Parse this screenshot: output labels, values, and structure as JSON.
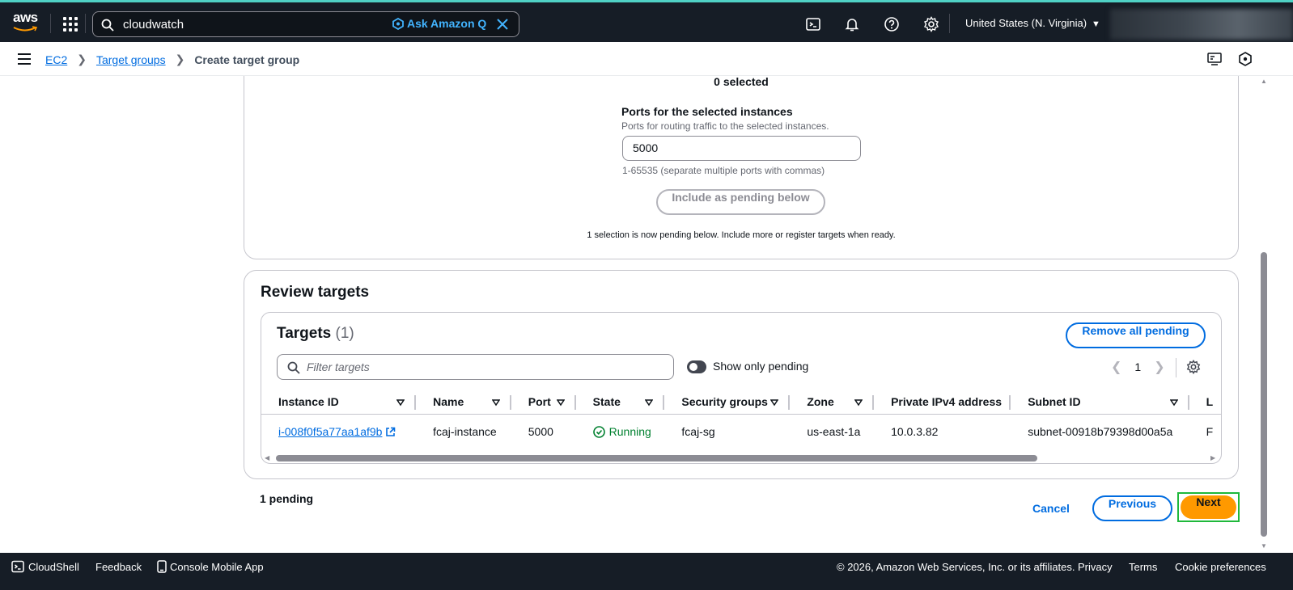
{
  "topnav": {
    "logo": "aws",
    "search_value": "cloudwatch",
    "ask_q": "Ask Amazon Q",
    "region": "United States (N. Virginia)"
  },
  "breadcrumb": {
    "items": [
      "EC2",
      "Target groups"
    ],
    "current": "Create target group"
  },
  "register": {
    "selected_count": "0 selected",
    "ports_label": "Ports for the selected instances",
    "ports_desc": "Ports for routing traffic to the selected instances.",
    "ports_value": "5000",
    "ports_hint": "1-65535 (separate multiple ports with commas)",
    "include_btn": "Include as pending below",
    "pending_note": "1 selection is now pending below. Include more or register targets when ready."
  },
  "review": {
    "title": "Review targets",
    "targets_title": "Targets",
    "targets_count": "(1)",
    "remove_btn": "Remove all pending",
    "filter_placeholder": "Filter targets",
    "toggle_label": "Show only pending",
    "page": "1",
    "columns": [
      "Instance ID",
      "Name",
      "Port",
      "State",
      "Security groups",
      "Zone",
      "Private IPv4 address",
      "Subnet ID",
      "L"
    ],
    "rows": [
      {
        "instance_id": "i-008f0f5a77aa1af9b",
        "name": "fcaj-instance",
        "port": "5000",
        "state": "Running",
        "security_groups": "fcaj-sg",
        "zone": "us-east-1a",
        "ipv4": "10.0.3.82",
        "subnet": "subnet-00918b79398d00a5a",
        "last": "F"
      }
    ]
  },
  "actions": {
    "pending_count": "1 pending",
    "cancel": "Cancel",
    "previous": "Previous",
    "next": "Next"
  },
  "footer": {
    "cloudshell": "CloudShell",
    "feedback": "Feedback",
    "mobile": "Console Mobile App",
    "copyright": "© 2026, Amazon Web Services, Inc. or its affiliates.",
    "privacy": "Privacy",
    "terms": "Terms",
    "cookies": "Cookie preferences"
  },
  "colors": {
    "nav_bg": "#161d26",
    "link": "#006ce0",
    "primary_btn": "#ff9900",
    "success": "#00802f",
    "highlight": "#1fb83b"
  }
}
